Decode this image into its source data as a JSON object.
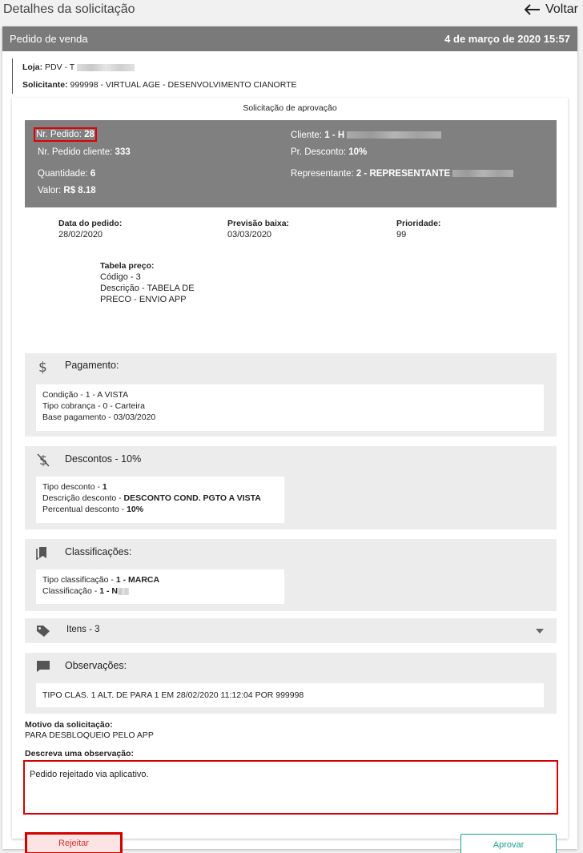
{
  "page": {
    "title": "Detalhes da solicitação",
    "back_label": "Voltar"
  },
  "header": {
    "type": "Pedido de venda",
    "date": "4 de março de 2020 15:57"
  },
  "info": {
    "loja_label": "Loja:",
    "loja_value": "PDV - T",
    "solicitante_label": "Solicitante:",
    "solicitante_value": "999998 - VIRTUAL AGE - DESENVOLVIMENTO CIANORTE"
  },
  "approval": {
    "title": "Solicitação de aprovação",
    "summary": {
      "nr_pedido_label": "Nr. Pedido:",
      "nr_pedido_value": "28",
      "nr_pedido_cliente_label": "Nr. Pedido cliente:",
      "nr_pedido_cliente_value": "333",
      "quantidade_label": "Quantidade:",
      "quantidade_value": "6",
      "valor_label": "Valor:",
      "valor_value": "R$ 8.18",
      "cliente_label": "Cliente:",
      "cliente_value": "1 - H",
      "desconto_label": "Pr. Desconto:",
      "desconto_value": "10%",
      "representante_label": "Representante:",
      "representante_value": "2 - REPRESENTANTE"
    },
    "dates": {
      "data_pedido_label": "Data do pedido:",
      "data_pedido_value": "28/02/2020",
      "previsao_label": "Previsão baixa:",
      "previsao_value": "03/03/2020",
      "prioridade_label": "Prioridade:",
      "prioridade_value": "99"
    },
    "tabela": {
      "label": "Tabela preço:",
      "codigo": "Código - 3",
      "descricao_line1": "Descrição - TABELA DE",
      "descricao_line2": "PRECO - ENVIO APP"
    }
  },
  "pagamento": {
    "title": "Pagamento:",
    "condicao": "Condição - 1 - A VISTA",
    "tipo_cobranca": "Tipo cobrança - 0 - Carteira",
    "base": "Base pagamento - 03/03/2020"
  },
  "descontos": {
    "title": "Descontos - 10%",
    "tipo_label": "Tipo desconto - ",
    "tipo_value": "1",
    "descricao_label": "Descrição desconto - ",
    "descricao_value": "DESCONTO COND. PGTO A VISTA",
    "percentual_label": "Percentual desconto - ",
    "percentual_value": "10%"
  },
  "classificacoes": {
    "title": "Classificações:",
    "tipo_label": "Tipo classificação - ",
    "tipo_value": "1 - MARCA",
    "class_label": "Classificação - ",
    "class_value": "1 - N"
  },
  "itens": {
    "title": "Itens - 3"
  },
  "observacoes": {
    "title": "Observações:",
    "text": "TIPO CLAS. 1 ALT. DE PARA 1 EM 28/02/2020 11:12:04 POR 999998"
  },
  "motivo": {
    "label": "Motivo da solicitação:",
    "value": "PARA DESBLOQUEIO PELO APP"
  },
  "observacao_input": {
    "label": "Descreva uma observação:",
    "value": "Pedido rejeitado via aplicativo."
  },
  "buttons": {
    "reject": "Rejeitar",
    "approve": "Aprovar"
  }
}
